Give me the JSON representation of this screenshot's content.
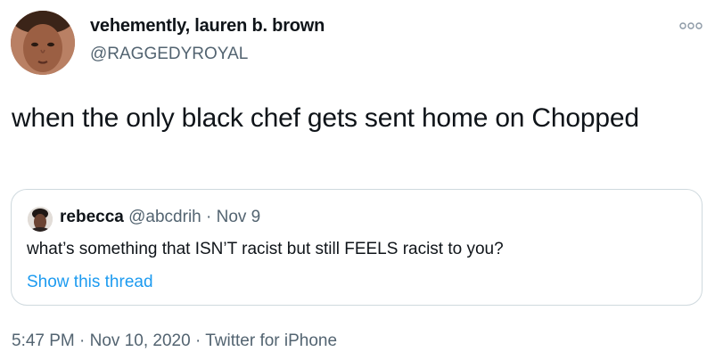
{
  "author": {
    "display_name": "vehemently, lauren b. brown",
    "handle": "@RAGGEDYROYAL",
    "avatar_icon": "profile-photo"
  },
  "more_icon": "more-options-icon",
  "tweet": {
    "text": "when the only black chef gets sent home on Chopped"
  },
  "quoted_tweet": {
    "name": "rebecca",
    "meta": " @abcdrih · Nov 9",
    "text": "what’s something that ISN’T racist but still FEELS racist to you?",
    "link": "Show this thread"
  },
  "footer": {
    "timestamp": "5:47 PM · Nov 10, 2020 · Twitter for iPhone"
  },
  "colors": {
    "text": "#0f1419",
    "secondary": "#536471",
    "link": "#1d9bf0",
    "border": "#cfd9de"
  }
}
